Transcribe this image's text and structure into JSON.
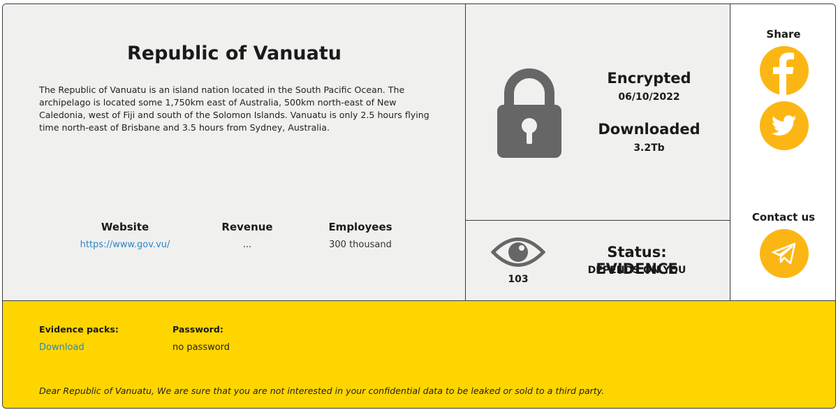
{
  "company": {
    "title": "Republic of Vanuatu",
    "description": "The Republic of Vanuatu is an island nation located in the South Pacific Ocean. The archipelago is located some 1,750km east of Australia, 500km north-east of New Caledonia, west of Fiji and south of the Solomon Islands. Vanuatu is only 2.5 hours flying time north-east of Brisbane and 3.5 hours from Sydney, Australia.",
    "stats": {
      "website_label": "Website",
      "website_value": "https://www.gov.vu/",
      "revenue_label": "Revenue",
      "revenue_value": "...",
      "employees_label": "Employees",
      "employees_value": "300 thousand"
    }
  },
  "encryption": {
    "icon": "lock-icon",
    "encrypted_label": "Encrypted",
    "encrypted_date": "06/10/2022",
    "downloaded_label": "Downloaded",
    "downloaded_size": "3.2Tb"
  },
  "status": {
    "icon": "eye-icon",
    "views": "103",
    "title": "Status: EVIDENCE",
    "subtitle": "DEPENDS ON YOU"
  },
  "sidebar": {
    "share_label": "Share",
    "contact_label": "Contact us",
    "icons": [
      "facebook-icon",
      "twitter-icon",
      "telegram-icon"
    ]
  },
  "footer": {
    "evidence_label": "Evidence packs:",
    "evidence_link": "Download",
    "password_label": "Password:",
    "password_value": "no password",
    "note": "Dear Republic of Vanuatu, We are sure that you are not interested in your confidential data to be leaked or sold to a third party."
  },
  "colors": {
    "panel_bg": "#f0f0ef",
    "footer_bg": "#ffd500",
    "accent_circle": "#fcb614",
    "link": "#2a86c8",
    "icon_gray": "#666666"
  }
}
